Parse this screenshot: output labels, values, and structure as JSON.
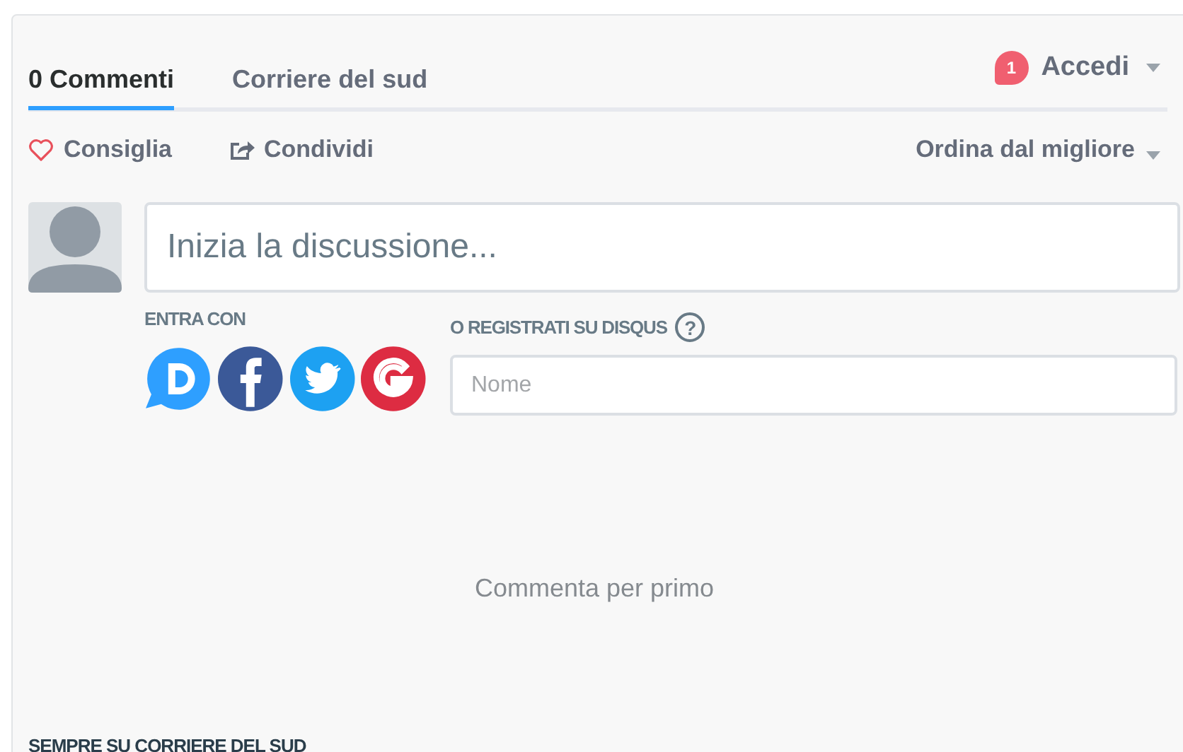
{
  "tabs": [
    {
      "label": "0 Commenti",
      "selected": true
    },
    {
      "label": "Corriere del sud",
      "selected": false
    }
  ],
  "login": {
    "badge": "1",
    "label": "Accedi"
  },
  "actions": [
    {
      "kind": "recommend",
      "label": "Consiglia"
    },
    {
      "kind": "share",
      "label": "Condividi"
    }
  ],
  "sort": {
    "label": "Ordina dal migliore"
  },
  "composer": {
    "placeholder": "Inizia la discussione..."
  },
  "login_with": {
    "label": "ENTRA CON",
    "services": [
      {
        "kind": "disqus"
      },
      {
        "kind": "facebook"
      },
      {
        "kind": "twitter"
      },
      {
        "kind": "google"
      }
    ]
  },
  "register": {
    "label": "O REGISTRATI SU DISQUS",
    "help": "?",
    "name_field": {
      "placeholder": "Nome"
    }
  },
  "empty_message": "Commenta per primo",
  "footer_heading": "SEMPRE SU CORRIERE DEL SUD"
}
